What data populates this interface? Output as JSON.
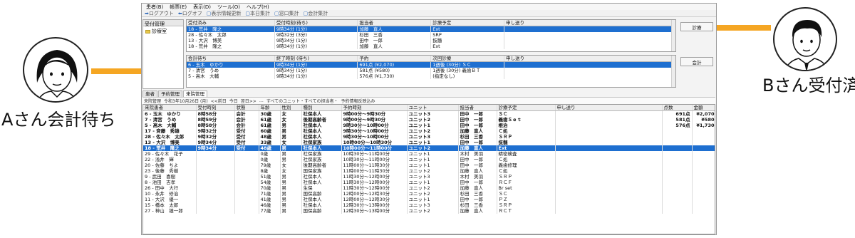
{
  "annotations": {
    "left_label": "Aさん会計待ち",
    "right_label": "Bさん受付済",
    "arrow_color": "#f5a623"
  },
  "app": {
    "menu": [
      "患者(B)",
      "帳票(E)",
      "表示(D)",
      "ツール(O)",
      "ヘルプ(H)"
    ],
    "toolbar": [
      {
        "icon": "arrow-right-icon",
        "label": "ログアウト"
      },
      {
        "icon": "arrow-left-icon",
        "label": "ログオフ"
      },
      {
        "icon": "doc-icon",
        "label": "表示情報更新"
      },
      {
        "icon": "doc-icon",
        "label": "本日集計"
      },
      {
        "icon": "doc-icon",
        "label": "窓口集計"
      },
      {
        "icon": "doc-icon",
        "label": "会計集計"
      }
    ],
    "left_panel": {
      "header": "受付管理",
      "item": "診療室"
    },
    "reception": {
      "columns": [
        "受付済み",
        "受付時刻(待ち)",
        "担当者",
        "診療予定",
        "申し送り"
      ],
      "rows": [
        [
          "18 - 荒井　隆之",
          "9時34分 (1分)",
          "加藤　直人",
          "Ext",
          ""
        ],
        [
          "28 - 佐々木　太郎",
          "9時32分 (3分)",
          "杉田　三香",
          "SRP",
          ""
        ],
        [
          "13 - 大沢　博美",
          "9時34分 (1分)",
          "田中　一郎",
          "抜髄",
          ""
        ],
        [
          "18 - 荒井　隆之",
          "9時34分 (1分)",
          "加藤　直人",
          "Ext",
          ""
        ]
      ],
      "button": "診療"
    },
    "accounting": {
      "columns": [
        "会計待ち",
        "終了時刻 (待ち)",
        "予約",
        "次回診療",
        "申し送り"
      ],
      "rows": [
        [
          "6 - 玉木　ゆかり",
          "9時34分 (1分)",
          "691点 (¥2,070)",
          "1週後 (30分) ＳＣ",
          ""
        ],
        [
          "7 - 清宮　うめ",
          "9時34分 (1分)",
          "581点 (¥580)",
          "1週後 (30分) 義歯ＢＴ",
          ""
        ],
        [
          "5 - 高木　大輔",
          "9時34分 (1分)",
          "576点 (¥1,730)",
          "(指定なし)",
          ""
        ]
      ],
      "button": "会計"
    },
    "tabs": [
      "患者",
      "予約管理",
      "来院管理"
    ],
    "filterbar": [
      "来院管理",
      "令和3年10月26日 (月)",
      "<<前日",
      "今日",
      "翌日>>",
      "…",
      "すべてのユニット・すべての担当者・",
      "予約情報反映込み"
    ],
    "main": {
      "columns": [
        "来院患者",
        "受付時刻",
        "状態",
        "年齢",
        "性別",
        "種別",
        "予約時刻",
        "ユニット",
        "担当者",
        "診療予定",
        "申し送り",
        "点数",
        "金額"
      ],
      "rows": [
        [
          "6 - 玉木　ゆかり",
          "8時58分",
          "会計",
          "30歳",
          "女",
          "社保本人",
          "9時00分～9時30分",
          "ユニット3",
          "田中　一郎",
          "ＳＣ",
          "",
          "691点",
          "¥2,070"
        ],
        [
          "7 - 清宮　うめ",
          "8時59分",
          "会計",
          "61歳",
          "女",
          "後期高齢者",
          "9時00分～9時30分",
          "ユニット2",
          "田中　一郎",
          "義歯Ｓｅｔ",
          "",
          "581点",
          "¥580"
        ],
        [
          "5 - 高木　大輔",
          "8時58分",
          "会計",
          "61歳",
          "男",
          "社保本人",
          "9時30分～10時00分",
          "ユニット1",
          "田中　一郎",
          "根治",
          "",
          "576点",
          "¥1,730"
        ],
        [
          "17 - 斉藤　秀雄",
          "9時32分",
          "受付",
          "60歳",
          "男",
          "社保本人",
          "9時30分～10時00分",
          "ユニット2",
          "加藤　直人",
          "Ｃ処",
          "",
          "",
          ""
        ],
        [
          "28 - 佐々木　太郎",
          "9時32分",
          "受付",
          "48歳",
          "男",
          "社保本人",
          "9時30分～10時00分",
          "ユニット3",
          "杉田　三香",
          "ＳＲＰ",
          "",
          "",
          ""
        ],
        [
          "13 - 大沢　博美",
          "9時34分",
          "受付",
          "33歳",
          "女",
          "社保家族",
          "10時00分～10時30分",
          "ユニット1",
          "田中　一郎",
          "抜髄",
          "",
          "",
          ""
        ],
        [
          "18 - 荒井　隆之",
          "9時34分",
          "受付",
          "48歳",
          "男",
          "社保本人",
          "10時00分～11時00分",
          "ユニット2",
          "加藤　直人",
          "Ext",
          "",
          "",
          ""
        ],
        [
          "29 - 佐々木　花子",
          "",
          "",
          "0歳",
          "男",
          "社保家族",
          "10時30分～11時00分",
          "ユニット1",
          "木村　美羽",
          "精密検査",
          "",
          "",
          ""
        ],
        [
          "22 - 浅井　輝",
          "",
          "",
          "0歳",
          "男",
          "社保家族",
          "10時30分～11時00分",
          "ユニット1",
          "田中　一郎",
          "Ｃ処",
          "",
          "",
          ""
        ],
        [
          "20 - 佐藤　ちよ",
          "",
          "",
          "79歳",
          "女",
          "後期高齢者",
          "11時00分～11時30分",
          "ユニット1",
          "田中　一郎",
          "義歯修理",
          "",
          "",
          ""
        ],
        [
          "23 - 後藤　秀樹",
          "",
          "",
          "8歳",
          "女",
          "国保家族",
          "11時00分～11時30分",
          "ユニット2",
          "加藤　直人",
          "Ｃ処",
          "",
          "",
          ""
        ],
        [
          "9 - 武田　喜樹",
          "",
          "",
          "51歳",
          "男",
          "社保本人",
          "11時30分～12時00分",
          "ユニット3",
          "木村　美羽",
          "ＳＲＰ",
          "",
          "",
          ""
        ],
        [
          "8 - 池田　吉孝",
          "",
          "",
          "54歳",
          "男",
          "社保本人",
          "11時30分～12時00分",
          "ユニット1",
          "田中　一郎",
          "ＲＣＦ",
          "",
          "",
          ""
        ],
        [
          "26 - 田中　大行",
          "",
          "",
          "70歳",
          "男",
          "生保",
          "11時30分～12時00分",
          "ユニット2",
          "加藤　直人",
          "Br set",
          "",
          "",
          ""
        ],
        [
          "10 - 永井　修治",
          "",
          "",
          "71歳",
          "男",
          "国保高齢",
          "12時00分～12時30分",
          "ユニット2",
          "杉田　三香",
          "ＳＣ",
          "",
          "",
          ""
        ],
        [
          "11 - 大沢　優一",
          "",
          "",
          "41歳",
          "男",
          "社保本人",
          "12時00分～12時30分",
          "ユニット1",
          "田中　一郎",
          "ＰＺ",
          "",
          "",
          ""
        ],
        [
          "15 - 橋本　太郎",
          "",
          "",
          "46歳",
          "男",
          "社保本人",
          "12時30分～13時00分",
          "ユニット3",
          "杉田　三香",
          "ＳＲＰ",
          "",
          "",
          ""
        ],
        [
          "27 - 神山　雄一郎",
          "",
          "",
          "77歳",
          "男",
          "国保高齢",
          "12時30分～13時00分",
          "ユニット2",
          "加藤　直人",
          "ＲＣＴ",
          "",
          "",
          ""
        ]
      ]
    }
  }
}
